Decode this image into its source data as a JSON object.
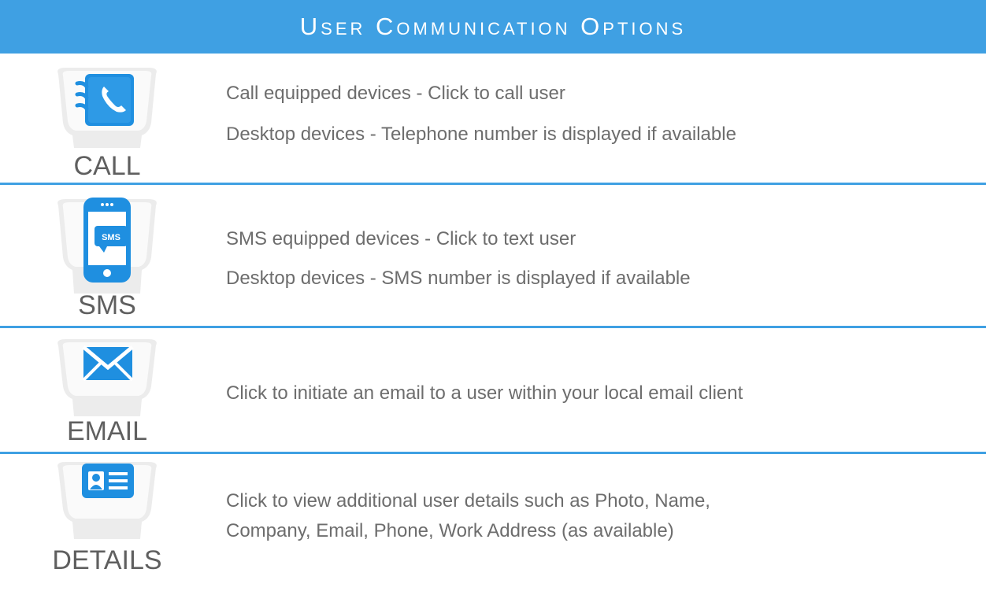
{
  "header": {
    "title": "User Communication Options"
  },
  "rows": [
    {
      "label": "CALL",
      "icon": "phone-book-icon",
      "lines": [
        "Call equipped devices - Click to call user",
        "Desktop devices - Telephone number is displayed if available"
      ]
    },
    {
      "label": "SMS",
      "icon": "sms-phone-icon",
      "lines": [
        "SMS equipped devices - Click to text user",
        "Desktop devices - SMS number is displayed if available"
      ]
    },
    {
      "label": "EMAIL",
      "icon": "envelope-icon",
      "lines": [
        "Click to initiate an email to a user within your local email client"
      ]
    },
    {
      "label": "DETAILS",
      "icon": "contact-card-icon",
      "lines": [
        "Click to view additional user details such as Photo, Name,",
        "Company, Email, Phone, Work Address (as available)"
      ]
    }
  ],
  "colors": {
    "accent": "#3fa0e3",
    "icon_blue": "#1f8fe0",
    "text": "#6d6d6d"
  }
}
